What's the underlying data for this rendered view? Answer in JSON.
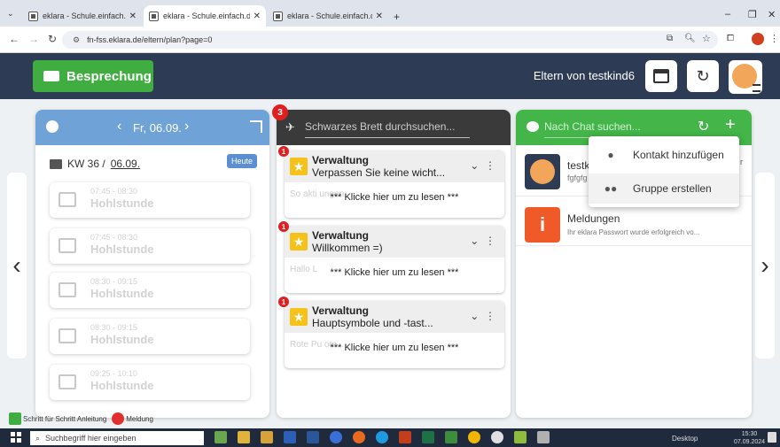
{
  "browser": {
    "tabs": [
      {
        "title": "eklara - Schule.einfach.digital.",
        "active": false
      },
      {
        "title": "eklara - Schule.einfach.digital.",
        "active": true
      },
      {
        "title": "eklara - Schule.einfach.digital.",
        "active": false
      }
    ],
    "url": "fn-fss.eklara.de/eltern/plan?page=0"
  },
  "header": {
    "meeting_button": "Besprechung",
    "title": "Eltern von testkind6"
  },
  "plan": {
    "date": "Fr, 06.09.",
    "week_label": "KW 36 /",
    "week_date": "06.09.",
    "today_button": "Heute",
    "slots": [
      {
        "time": "07:45 - 08:30",
        "name": "Hohlstunde"
      },
      {
        "time": "07:45 - 08:30",
        "name": "Hohlstunde"
      },
      {
        "time": "08:30 - 09:15",
        "name": "Hohlstunde"
      },
      {
        "time": "08:30 - 09:15",
        "name": "Hohlstunde"
      },
      {
        "time": "09:25 - 10:10",
        "name": "Hohlstunde"
      }
    ]
  },
  "board": {
    "badge": "3",
    "search_placeholder": "Schwarzes Brett durchsuchen...",
    "posts": [
      {
        "badge": "1",
        "from": "Verwaltung",
        "subject": "Verpassen Sie keine wicht...",
        "preview": "So akti                                         ungen",
        "read_text": "*** Klicke hier um zu lesen ***"
      },
      {
        "badge": "1",
        "from": "Verwaltung",
        "subject": "Willkommen =)",
        "preview": "Hallo L",
        "read_text": "*** Klicke hier um zu lesen ***"
      },
      {
        "badge": "1",
        "from": "Verwaltung",
        "subject": "Hauptsymbole und -tast...",
        "preview": "Rote Pu                                              ote...",
        "read_text": "*** Klicke hier um zu lesen ***"
      }
    ]
  },
  "chat": {
    "search_placeholder": "Nach Chat suchen...",
    "rows": [
      {
        "name": "testk",
        "preview": "fgfgfg",
        "time": "r"
      },
      {
        "name": "Meldungen",
        "preview": "Ihr eklara Passwort wurde erfolgreich vo...",
        "time": ""
      }
    ],
    "menu": [
      {
        "label": "Kontakt hinzufügen",
        "icon": "person-icon"
      },
      {
        "label": "Gruppe erstellen",
        "icon": "group-icon"
      }
    ]
  },
  "legend": [
    {
      "label": "Schritt für Schritt Anleitung",
      "color": "#3fad3f"
    },
    {
      "label": "Meldung",
      "color": "#e03030"
    }
  ],
  "taskbar": {
    "search_placeholder": "Suchbegriff hier eingeben",
    "desktop": "Desktop",
    "time": "15:30",
    "date": "07.09.2024"
  }
}
